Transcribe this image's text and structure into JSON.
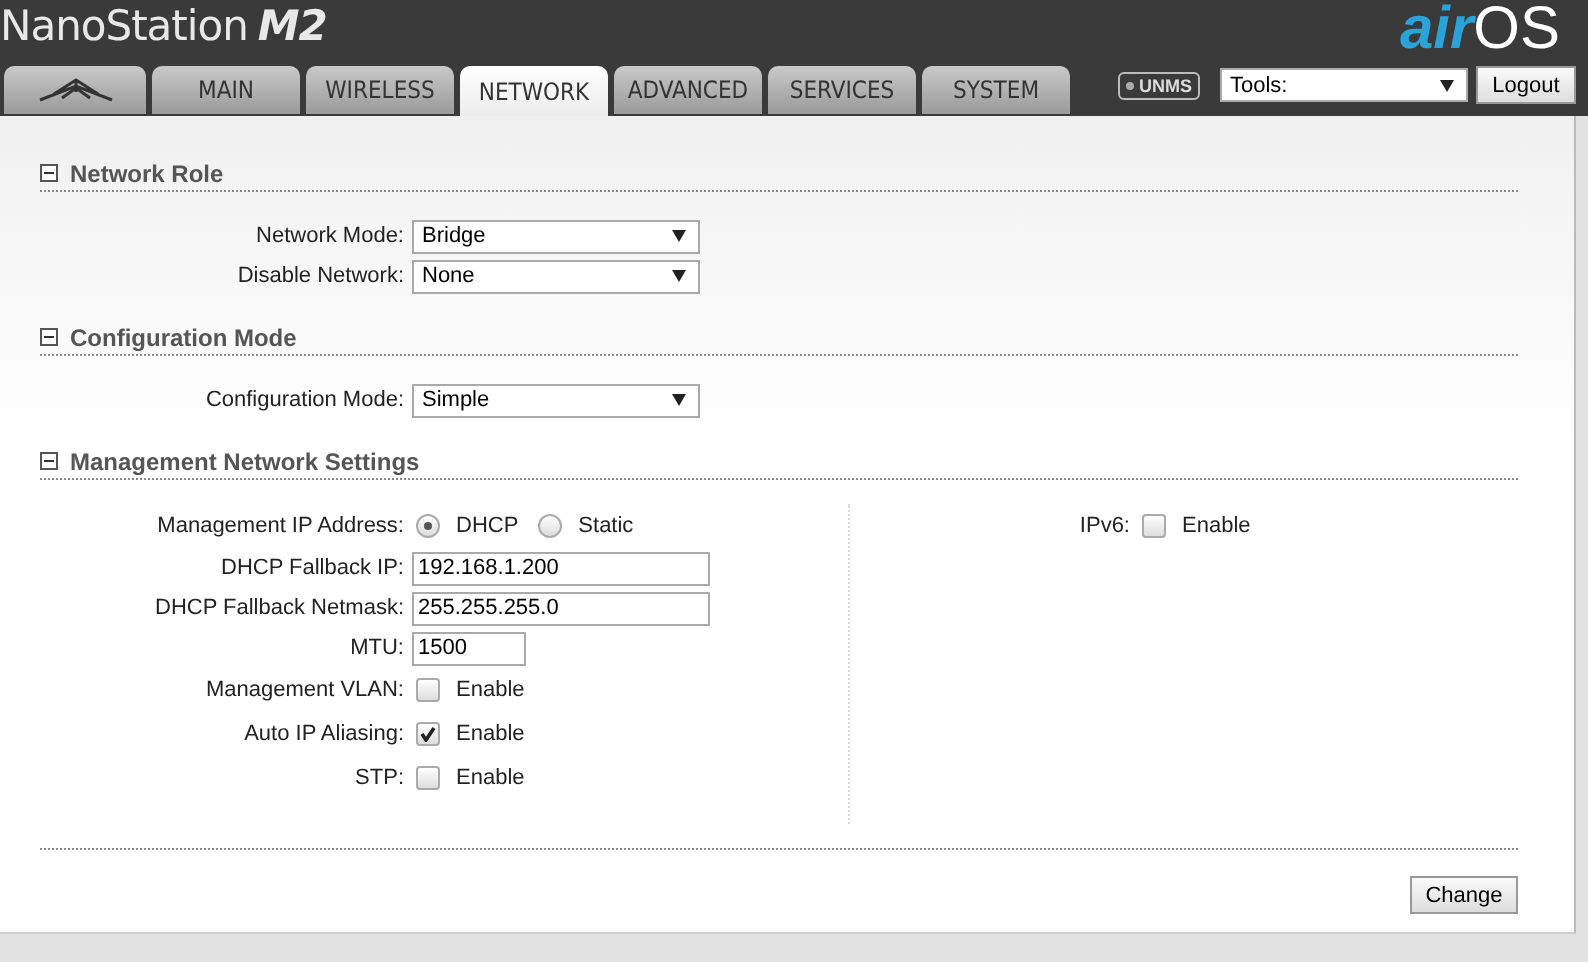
{
  "header": {
    "product": "NanoStation",
    "model": "M2",
    "brand_prefix": "air",
    "brand_suffix": "OS"
  },
  "tabs": [
    {
      "kind": "logo",
      "selected": false
    },
    {
      "kind": "text",
      "label": "MAIN",
      "selected": false
    },
    {
      "kind": "text",
      "label": "WIRELESS",
      "selected": false
    },
    {
      "kind": "text",
      "label": "NETWORK",
      "selected": true
    },
    {
      "kind": "text",
      "label": "ADVANCED",
      "selected": false
    },
    {
      "kind": "text",
      "label": "SERVICES",
      "selected": false
    },
    {
      "kind": "text",
      "label": "SYSTEM",
      "selected": false
    }
  ],
  "toolbar": {
    "badge": "UNMS",
    "tools": {
      "value": "Tools:"
    },
    "logout": "Logout"
  },
  "sections": [
    {
      "title": "Network Role",
      "expanded": true,
      "left": [
        {
          "kind": "select",
          "label": "Network Mode:",
          "value": "Bridge"
        },
        {
          "kind": "select",
          "label": "Disable Network:",
          "value": "None"
        }
      ]
    },
    {
      "title": "Configuration Mode",
      "expanded": true,
      "left": [
        {
          "kind": "select",
          "label": "Configuration Mode:",
          "value": "Simple"
        }
      ]
    },
    {
      "title": "Management Network Settings",
      "expanded": true,
      "left": [
        {
          "kind": "radio",
          "label": "Management IP Address:",
          "options": [
            {
              "label": "DHCP",
              "selected": true
            },
            {
              "label": "Static",
              "selected": false
            }
          ]
        },
        {
          "kind": "text",
          "label": "DHCP Fallback IP:",
          "value": "192.168.1.200"
        },
        {
          "kind": "text",
          "label": "DHCP Fallback Netmask:",
          "value": "255.255.255.0"
        },
        {
          "kind": "number",
          "label": "MTU:",
          "value": "1500"
        },
        {
          "kind": "checkbox",
          "label": "Management VLAN:",
          "option": "Enable",
          "checked": false
        },
        {
          "kind": "checkbox",
          "label": "Auto IP Aliasing:",
          "option": "Enable",
          "checked": true
        },
        {
          "kind": "checkbox",
          "label": "STP:",
          "option": "Enable",
          "checked": false
        }
      ],
      "right": [
        {
          "kind": "checkbox",
          "label": "IPv6:",
          "option": "Enable",
          "checked": false
        }
      ]
    }
  ],
  "change_button": "Change"
}
